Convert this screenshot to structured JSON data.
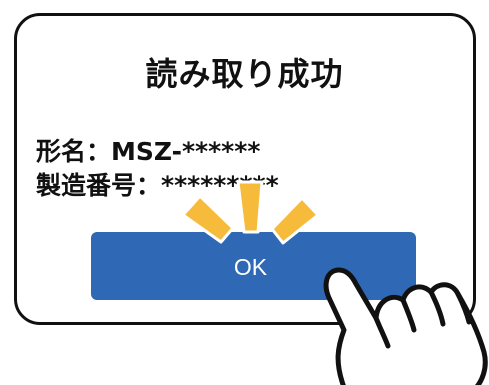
{
  "dialog": {
    "title": "読み取り成功",
    "model_label": "形名：",
    "model_value": "MSZ-******",
    "serial_label": "製造番号：",
    "serial_value": "*********",
    "ok_label": "OK"
  },
  "colors": {
    "button": "#2f69b5",
    "button_text": "#ffffff",
    "tap_burst": "#f7bb3c",
    "border": "#111111"
  },
  "icons": {
    "tap_burst": "tap-burst-icon",
    "pointing_hand": "pointing-hand-icon"
  }
}
